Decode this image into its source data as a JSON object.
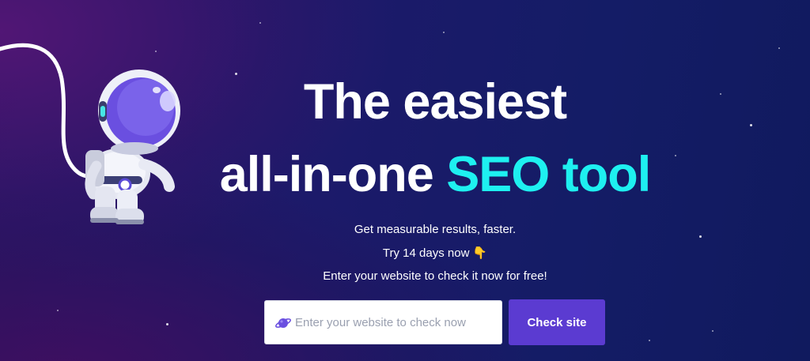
{
  "hero": {
    "headline_line1": "The easiest",
    "headline_line2_prefix": "all-in-one ",
    "headline_line2_accent": "SEO tool",
    "subtitle_1": "Get measurable results, faster.",
    "subtitle_2": "Try 14 days now",
    "subtitle_2_icon": "pointing-down-hand-icon",
    "subtitle_3": "Enter your website to check it now for free!",
    "illustration": "astronaut-illustration"
  },
  "search": {
    "placeholder": "Enter your website to check now",
    "value": "",
    "icon": "planet-icon"
  },
  "cta": {
    "label": "Check site"
  },
  "colors": {
    "accent_text": "#1ef0f0",
    "button": "#5b3bd1",
    "background_dark": "#141c66"
  }
}
